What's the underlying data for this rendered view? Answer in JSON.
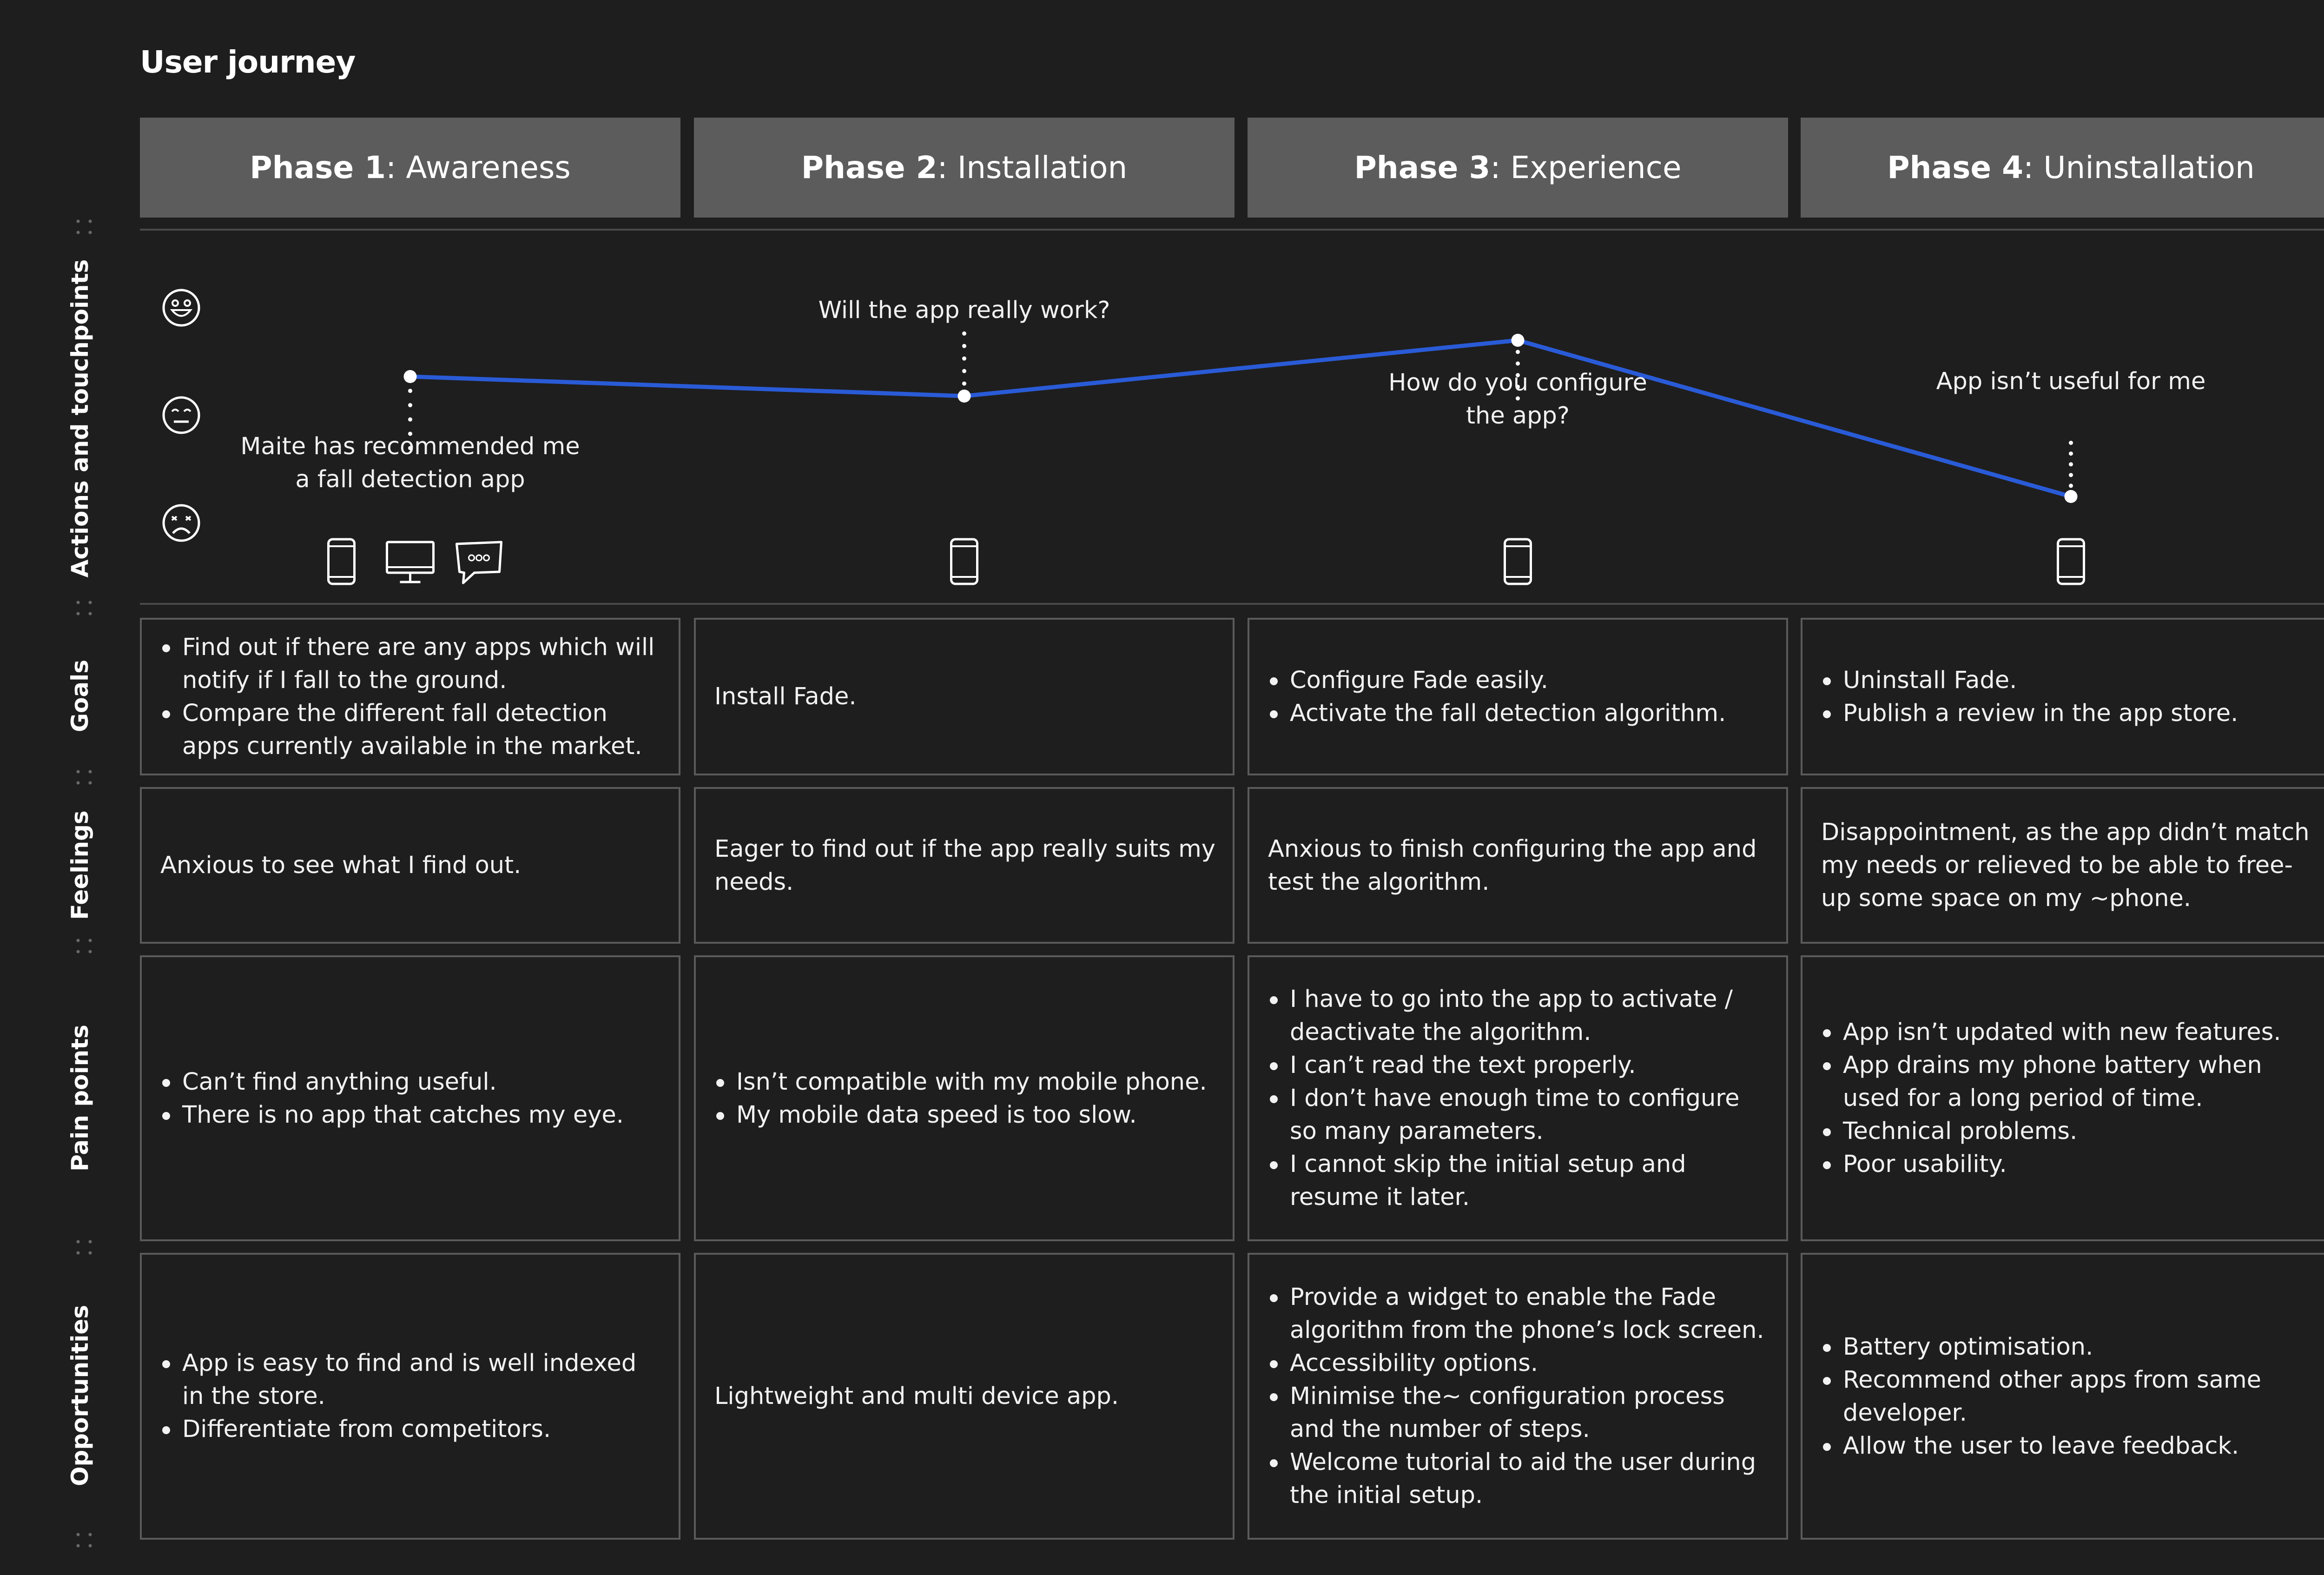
{
  "title": "User journey",
  "colors": {
    "background": "#1e1e1e",
    "phase_header": "#5c5c5c",
    "journey_line": "#2a5bd7",
    "cell_border": "#5a5a5a"
  },
  "phases": [
    {
      "number": "Phase 1",
      "name": "Awareness"
    },
    {
      "number": "Phase 2",
      "name": "Installation"
    },
    {
      "number": "Phase 3",
      "name": "Experience"
    },
    {
      "number": "Phase 4",
      "name": "Uninstallation"
    }
  ],
  "row_labels": {
    "actions": "Actions and touchpoints",
    "goals": "Goals",
    "feelings": "Feelings",
    "pain_points": "Pain points",
    "opportunities": "Opportunities"
  },
  "emotion_scale": [
    "happy-face-icon",
    "neutral-face-icon",
    "sad-face-icon"
  ],
  "journey": {
    "points": [
      {
        "phase": "Phase 1",
        "emotion_level": 0.45,
        "text_lines": [
          "Maite has recommended me",
          "a fall detection app"
        ],
        "touchpoints": [
          "mobile-phone-icon",
          "desktop-monitor-icon",
          "chat-bubble-icon"
        ]
      },
      {
        "phase": "Phase 2",
        "emotion_level": 0.38,
        "text_lines": [
          "Will the app really work?"
        ],
        "touchpoints": [
          "mobile-phone-icon"
        ]
      },
      {
        "phase": "Phase 3",
        "emotion_level": 0.58,
        "text_lines": [
          "How do you configure",
          "the app?"
        ],
        "touchpoints": [
          "mobile-phone-icon"
        ]
      },
      {
        "phase": "Phase 4",
        "emotion_level": 0.02,
        "text_lines": [
          "App isn’t useful for me"
        ],
        "touchpoints": [
          "mobile-phone-icon"
        ]
      }
    ]
  },
  "goals": [
    [
      "Find out if there are any apps which will notify if I fall to the ground.",
      "Compare the different fall detection apps currently available in the market."
    ],
    "Install Fade.",
    [
      "Configure Fade easily.",
      "Activate the fall detection algorithm."
    ],
    [
      "Uninstall Fade.",
      "Publish a review in the app store."
    ]
  ],
  "feelings": [
    "Anxious to see what I find out.",
    "Eager to find out if the app really suits my needs.",
    "Anxious to finish configuring the app and test the algorithm.",
    "Disappointment, as the app didn’t match my needs or relieved to be able to free-up some space on my ~phone."
  ],
  "pain_points": [
    [
      "Can’t find anything useful.",
      "There is no app that catches my eye."
    ],
    [
      "Isn’t compatible with my mobile phone.",
      "My mobile data speed is too slow."
    ],
    [
      "I have to go into the app to activate / deactivate the algorithm.",
      "I can’t read the text properly.",
      "I don’t have enough time to configure so many parameters.",
      "I cannot skip the initial setup and resume it later."
    ],
    [
      "App isn’t updated with new features.",
      "App drains my phone battery when used for a long period of time.",
      "Technical problems.",
      "Poor usability."
    ]
  ],
  "opportunities": [
    [
      "App is easy to find and is well indexed in the store.",
      "Differentiate from competitors."
    ],
    "Lightweight and multi device app.",
    [
      "Provide a widget to enable the Fade algorithm from the phone’s lock screen.",
      "Accessibility options.",
      "Minimise the~ configuration process and the number of steps.",
      "Welcome tutorial to aid the user during the initial setup."
    ],
    [
      "Battery optimisation.",
      "Recommend other apps from same developer.",
      "Allow the user to leave feedback."
    ]
  ]
}
